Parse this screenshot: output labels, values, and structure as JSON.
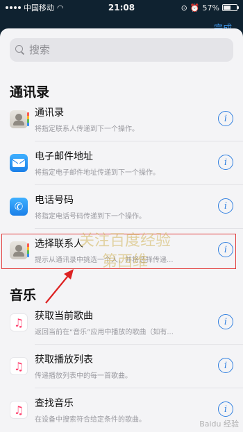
{
  "status_bar": {
    "carrier": "中国移动",
    "time": "21:08",
    "battery": "57%",
    "battery_level": 0.57
  },
  "peek": {
    "done_label": "完成"
  },
  "search": {
    "placeholder": "搜索"
  },
  "sections": [
    {
      "title": "通讯录",
      "items": [
        {
          "icon": "contacts-icon",
          "name": "通讯录",
          "desc": "将指定联系人传递到下一个操作。"
        },
        {
          "icon": "mail-icon",
          "name": "电子邮件地址",
          "desc": "将指定电子邮件地址传递到下一个操作。"
        },
        {
          "icon": "phone-icon",
          "name": "电话号码",
          "desc": "将指定电话号码传递到下一个操作。"
        },
        {
          "icon": "contacts-icon",
          "name": "选择联系人",
          "desc": "提示从通讯录中挑选一个人，并将选择传递..."
        }
      ]
    },
    {
      "title": "音乐",
      "items": [
        {
          "icon": "music-icon",
          "name": "获取当前歌曲",
          "desc": "返回当前在“音乐”应用中播放的歌曲（如有..."
        },
        {
          "icon": "music-icon",
          "name": "获取播放列表",
          "desc": "传递播放列表中的每一首歌曲。"
        },
        {
          "icon": "music-icon",
          "name": "查找音乐",
          "desc": "在设备中搜索符合给定条件的歌曲。"
        }
      ]
    }
  ],
  "info_glyph": "i",
  "watermark": {
    "line1": "关注百度经验",
    "line2": "第西维"
  },
  "baidu_mark": "Baidu 经验"
}
